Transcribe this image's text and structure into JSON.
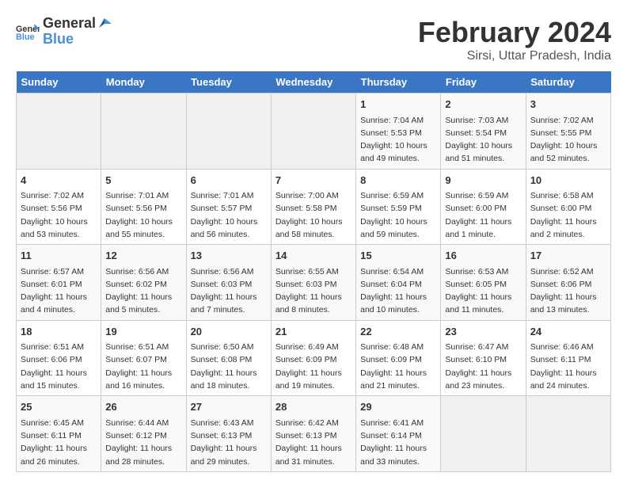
{
  "header": {
    "logo_general": "General",
    "logo_blue": "Blue",
    "title": "February 2024",
    "subtitle": "Sirsi, Uttar Pradesh, India"
  },
  "weekdays": [
    "Sunday",
    "Monday",
    "Tuesday",
    "Wednesday",
    "Thursday",
    "Friday",
    "Saturday"
  ],
  "weeks": [
    [
      {
        "day": "",
        "info": ""
      },
      {
        "day": "",
        "info": ""
      },
      {
        "day": "",
        "info": ""
      },
      {
        "day": "",
        "info": ""
      },
      {
        "day": "1",
        "info": "Sunrise: 7:04 AM\nSunset: 5:53 PM\nDaylight: 10 hours\nand 49 minutes."
      },
      {
        "day": "2",
        "info": "Sunrise: 7:03 AM\nSunset: 5:54 PM\nDaylight: 10 hours\nand 51 minutes."
      },
      {
        "day": "3",
        "info": "Sunrise: 7:02 AM\nSunset: 5:55 PM\nDaylight: 10 hours\nand 52 minutes."
      }
    ],
    [
      {
        "day": "4",
        "info": "Sunrise: 7:02 AM\nSunset: 5:56 PM\nDaylight: 10 hours\nand 53 minutes."
      },
      {
        "day": "5",
        "info": "Sunrise: 7:01 AM\nSunset: 5:56 PM\nDaylight: 10 hours\nand 55 minutes."
      },
      {
        "day": "6",
        "info": "Sunrise: 7:01 AM\nSunset: 5:57 PM\nDaylight: 10 hours\nand 56 minutes."
      },
      {
        "day": "7",
        "info": "Sunrise: 7:00 AM\nSunset: 5:58 PM\nDaylight: 10 hours\nand 58 minutes."
      },
      {
        "day": "8",
        "info": "Sunrise: 6:59 AM\nSunset: 5:59 PM\nDaylight: 10 hours\nand 59 minutes."
      },
      {
        "day": "9",
        "info": "Sunrise: 6:59 AM\nSunset: 6:00 PM\nDaylight: 11 hours\nand 1 minute."
      },
      {
        "day": "10",
        "info": "Sunrise: 6:58 AM\nSunset: 6:00 PM\nDaylight: 11 hours\nand 2 minutes."
      }
    ],
    [
      {
        "day": "11",
        "info": "Sunrise: 6:57 AM\nSunset: 6:01 PM\nDaylight: 11 hours\nand 4 minutes."
      },
      {
        "day": "12",
        "info": "Sunrise: 6:56 AM\nSunset: 6:02 PM\nDaylight: 11 hours\nand 5 minutes."
      },
      {
        "day": "13",
        "info": "Sunrise: 6:56 AM\nSunset: 6:03 PM\nDaylight: 11 hours\nand 7 minutes."
      },
      {
        "day": "14",
        "info": "Sunrise: 6:55 AM\nSunset: 6:03 PM\nDaylight: 11 hours\nand 8 minutes."
      },
      {
        "day": "15",
        "info": "Sunrise: 6:54 AM\nSunset: 6:04 PM\nDaylight: 11 hours\nand 10 minutes."
      },
      {
        "day": "16",
        "info": "Sunrise: 6:53 AM\nSunset: 6:05 PM\nDaylight: 11 hours\nand 11 minutes."
      },
      {
        "day": "17",
        "info": "Sunrise: 6:52 AM\nSunset: 6:06 PM\nDaylight: 11 hours\nand 13 minutes."
      }
    ],
    [
      {
        "day": "18",
        "info": "Sunrise: 6:51 AM\nSunset: 6:06 PM\nDaylight: 11 hours\nand 15 minutes."
      },
      {
        "day": "19",
        "info": "Sunrise: 6:51 AM\nSunset: 6:07 PM\nDaylight: 11 hours\nand 16 minutes."
      },
      {
        "day": "20",
        "info": "Sunrise: 6:50 AM\nSunset: 6:08 PM\nDaylight: 11 hours\nand 18 minutes."
      },
      {
        "day": "21",
        "info": "Sunrise: 6:49 AM\nSunset: 6:09 PM\nDaylight: 11 hours\nand 19 minutes."
      },
      {
        "day": "22",
        "info": "Sunrise: 6:48 AM\nSunset: 6:09 PM\nDaylight: 11 hours\nand 21 minutes."
      },
      {
        "day": "23",
        "info": "Sunrise: 6:47 AM\nSunset: 6:10 PM\nDaylight: 11 hours\nand 23 minutes."
      },
      {
        "day": "24",
        "info": "Sunrise: 6:46 AM\nSunset: 6:11 PM\nDaylight: 11 hours\nand 24 minutes."
      }
    ],
    [
      {
        "day": "25",
        "info": "Sunrise: 6:45 AM\nSunset: 6:11 PM\nDaylight: 11 hours\nand 26 minutes."
      },
      {
        "day": "26",
        "info": "Sunrise: 6:44 AM\nSunset: 6:12 PM\nDaylight: 11 hours\nand 28 minutes."
      },
      {
        "day": "27",
        "info": "Sunrise: 6:43 AM\nSunset: 6:13 PM\nDaylight: 11 hours\nand 29 minutes."
      },
      {
        "day": "28",
        "info": "Sunrise: 6:42 AM\nSunset: 6:13 PM\nDaylight: 11 hours\nand 31 minutes."
      },
      {
        "day": "29",
        "info": "Sunrise: 6:41 AM\nSunset: 6:14 PM\nDaylight: 11 hours\nand 33 minutes."
      },
      {
        "day": "",
        "info": ""
      },
      {
        "day": "",
        "info": ""
      }
    ]
  ]
}
